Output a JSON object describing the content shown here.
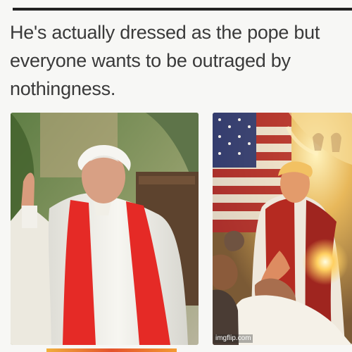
{
  "post": {
    "text_lines": [
      "He's actually dressed as the pope but",
      "everyone wants to be outraged by",
      "nothingness."
    ]
  },
  "images": [
    {
      "alt": "Pope in white cassock with red stole and white zucchetto, raised hand",
      "colors": {
        "robe": "#f2f0ea",
        "stole": "#e52a26",
        "background": "#7b8d55"
      }
    },
    {
      "alt": "Painting of a figure in white robe and red sash with American flag and glowing light",
      "colors": {
        "robe": "#efe8dc",
        "sash": "#b52a21",
        "glow": "#f8d36a",
        "flag_blue": "#2b3a77",
        "flag_red": "#b22b2b"
      }
    }
  ],
  "watermark": {
    "text": "imgflip.com"
  }
}
